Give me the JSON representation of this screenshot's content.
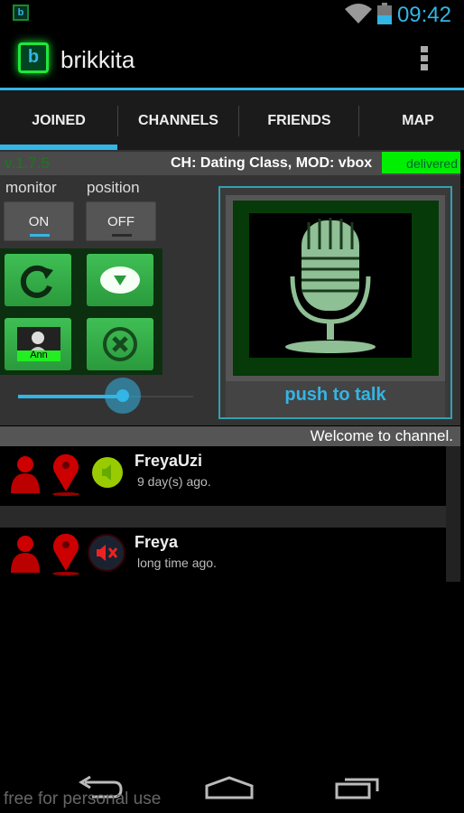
{
  "status_bar": {
    "time": "09:42",
    "notification_icon": "brikkita-icon",
    "wifi_icon": "wifi-icon",
    "battery_icon": "battery-icon"
  },
  "app_bar": {
    "title": "brikkita",
    "logo_letter": "b",
    "menu_icon": "overflow-menu-icon"
  },
  "tabs": [
    {
      "label": "JOINED",
      "selected": true
    },
    {
      "label": "CHANNELS"
    },
    {
      "label": "FRIENDS"
    },
    {
      "label": "MAP"
    }
  ],
  "header": {
    "version": "v.1.7.5",
    "channel": "CH: Dating Class, MOD: vbox",
    "delivery_status": "delivered",
    "delivery_color": "#00ee00"
  },
  "controls": {
    "monitor": {
      "label": "monitor",
      "value": "ON"
    },
    "position": {
      "label": "position",
      "value": "OFF"
    },
    "buttons": [
      {
        "icon": "refresh-icon"
      },
      {
        "icon": "dropdown-icon"
      },
      {
        "icon": "avatar-icon",
        "label": "Ann"
      },
      {
        "icon": "cancel-icon"
      }
    ],
    "volume_percent": 60
  },
  "push_to_talk": {
    "label": "push to talk",
    "icon": "microphone-icon"
  },
  "welcome_message": "Welcome to channel.",
  "users": [
    {
      "name": "FreyaUzi",
      "last_seen": "9 day(s) ago.",
      "audio": "speaker-on"
    },
    {
      "name": "Freya",
      "last_seen": "long time ago.",
      "audio": "speaker-muted"
    }
  ],
  "footer": {
    "watermark": "free for personal use"
  },
  "accent": "#33b5e5"
}
